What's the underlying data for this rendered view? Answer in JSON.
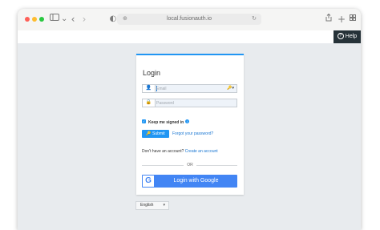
{
  "browser": {
    "url": "local.fusionauth.io"
  },
  "header": {
    "help_label": "Help",
    "help_icon_glyph": "?"
  },
  "login": {
    "title": "Login",
    "email_placeholder": "Email",
    "password_placeholder": "Password",
    "remember_label": "Keep me signed in",
    "submit_label": "Submit",
    "forgot_label": "Forgot your password?",
    "no_account_text": "Don't have an account?",
    "create_account_label": "Create an account",
    "or_label": "OR",
    "google_label": "Login with Google"
  },
  "language": {
    "selected": "English"
  },
  "colors": {
    "accent": "#2196f3",
    "google": "#4285f4",
    "help_bg": "#263238",
    "page_bg": "#e8ebee"
  }
}
